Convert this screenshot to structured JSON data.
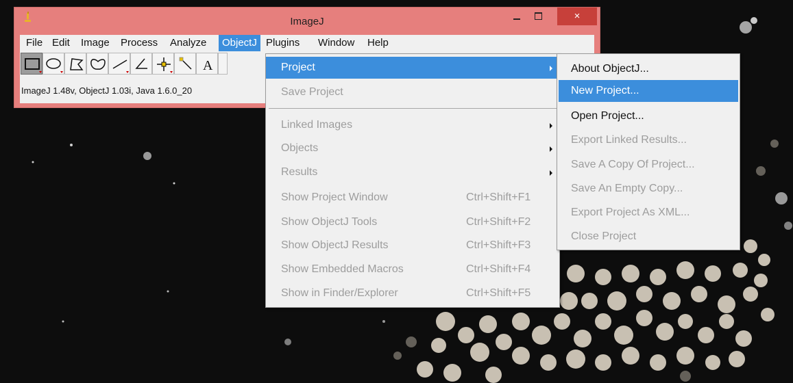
{
  "window": {
    "title": "ImageJ",
    "close_glyph": "×",
    "status_text": "ImageJ 1.48v,  ObjectJ 1.03i,  Java 1.6.0_20"
  },
  "menubar": {
    "items": [
      "File",
      "Edit",
      "Image",
      "Process",
      "Analyze",
      "ObjectJ",
      "Plugins",
      "Window",
      "Help"
    ],
    "active": "ObjectJ"
  },
  "toolbar": {
    "tools": [
      "rectangle-tool",
      "oval-tool",
      "polygon-tool",
      "freehand-tool",
      "line-tool",
      "angle-tool",
      "point-tool",
      "wand-tool",
      "text-tool"
    ],
    "text_tool_glyph": "A"
  },
  "objectj_menu": {
    "items": [
      {
        "label": "Project",
        "shortcut": "",
        "submenu": true,
        "enabled": true,
        "active": true
      },
      {
        "label": "Save Project",
        "shortcut": "",
        "submenu": false,
        "enabled": false
      },
      {
        "label": "Linked Images",
        "shortcut": "",
        "submenu": true,
        "enabled": false
      },
      {
        "label": "Objects",
        "shortcut": "",
        "submenu": true,
        "enabled": false
      },
      {
        "label": "Results",
        "shortcut": "",
        "submenu": true,
        "enabled": false
      },
      {
        "label": "Show Project Window",
        "shortcut": "Ctrl+Shift+F1",
        "enabled": false
      },
      {
        "label": "Show ObjectJ Tools",
        "shortcut": "Ctrl+Shift+F2",
        "enabled": false
      },
      {
        "label": "Show ObjectJ Results",
        "shortcut": "Ctrl+Shift+F3",
        "enabled": false
      },
      {
        "label": "Show Embedded Macros",
        "shortcut": "Ctrl+Shift+F4",
        "enabled": false
      },
      {
        "label": "Show in Finder/Explorer",
        "shortcut": "Ctrl+Shift+F5",
        "enabled": false
      }
    ]
  },
  "project_submenu": {
    "items": [
      {
        "label": "About ObjectJ...",
        "enabled": true
      },
      {
        "label": "New Project...",
        "enabled": true,
        "active": true
      },
      {
        "label": "Open Project...",
        "enabled": true
      },
      {
        "label": "Export Linked Results...",
        "enabled": false
      },
      {
        "label": "Save A Copy Of Project...",
        "enabled": false
      },
      {
        "label": "Save An Empty Copy...",
        "enabled": false
      },
      {
        "label": "Export Project As XML...",
        "enabled": false
      },
      {
        "label": "Close Project",
        "enabled": false
      }
    ]
  },
  "colors": {
    "titlebar": "#e67f7d",
    "close_button": "#c7403a",
    "menu_highlight": "#3c8edc",
    "disabled_text": "#9d9d9d",
    "background_image": "#0d0d0d"
  }
}
